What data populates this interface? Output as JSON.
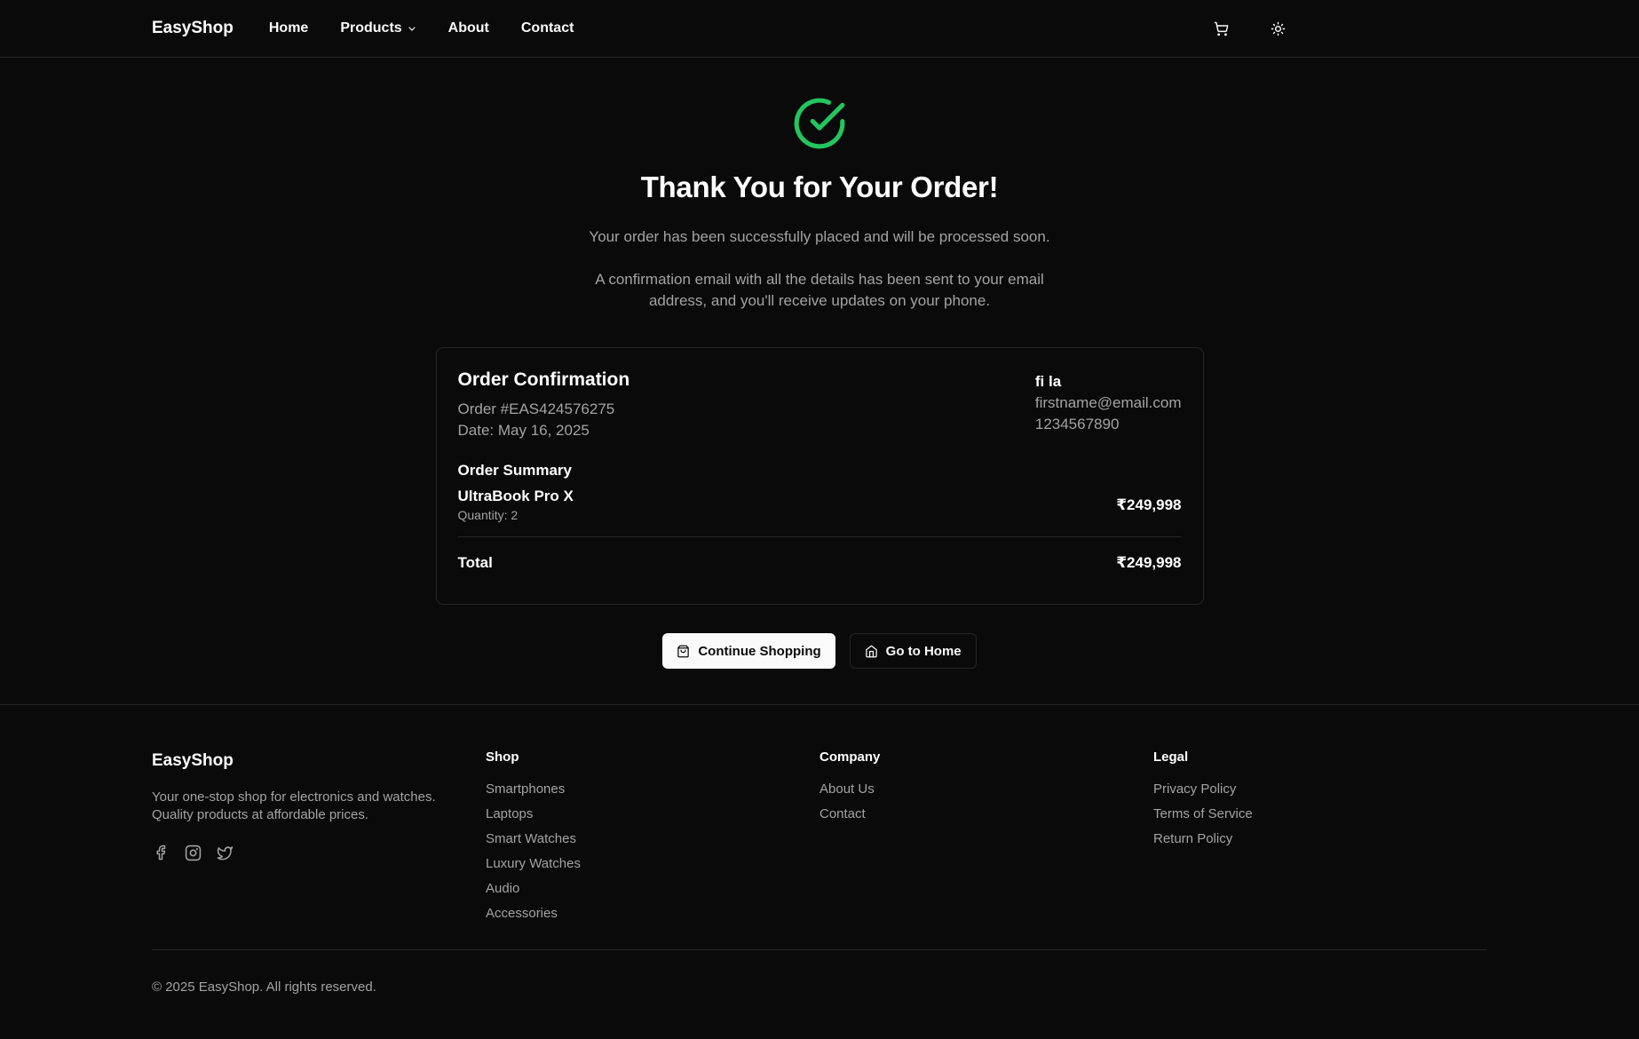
{
  "header": {
    "brand": "EasyShop",
    "nav": [
      {
        "label": "Home"
      },
      {
        "label": "Products"
      },
      {
        "label": "About"
      },
      {
        "label": "Contact"
      }
    ],
    "icons": [
      "cart-icon",
      "sun-icon"
    ]
  },
  "confirmation": {
    "icon": "check-circle-icon",
    "accent_color": "#22c55e",
    "title": "Thank You for Your Order!",
    "message": "Your order has been successfully placed and will be processed soon.",
    "email_note": "A confirmation email with all the details has been sent to your email address, and you'll receive updates on your phone."
  },
  "order": {
    "heading": "Order Confirmation",
    "number": "Order #EAS424576275",
    "date": "Date: May 16, 2025",
    "customer": {
      "name": "fi la",
      "email": "firstname@email.com",
      "phone": "1234567890"
    },
    "summary_title": "Order Summary",
    "items": [
      {
        "name": "UltraBook Pro X",
        "quantity": "Quantity: 2",
        "price": "₹249,998"
      }
    ],
    "total_label": "Total",
    "total_value": "₹249,998"
  },
  "actions": {
    "continue_label": "Continue Shopping",
    "home_label": "Go to Home"
  },
  "footer": {
    "brand": "EasyShop",
    "description": "Your one-stop shop for electronics and watches. Quality products at affordable prices.",
    "socials": [
      "facebook-icon",
      "instagram-icon",
      "twitter-icon"
    ],
    "columns": [
      {
        "heading": "Shop",
        "links": [
          "Smartphones",
          "Laptops",
          "Smart Watches",
          "Luxury Watches",
          "Audio",
          "Accessories"
        ]
      },
      {
        "heading": "Company",
        "links": [
          "About Us",
          "Contact"
        ]
      },
      {
        "heading": "Legal",
        "links": [
          "Privacy Policy",
          "Terms of Service",
          "Return Policy"
        ]
      }
    ],
    "copyright": "© 2025 EasyShop. All rights reserved."
  }
}
